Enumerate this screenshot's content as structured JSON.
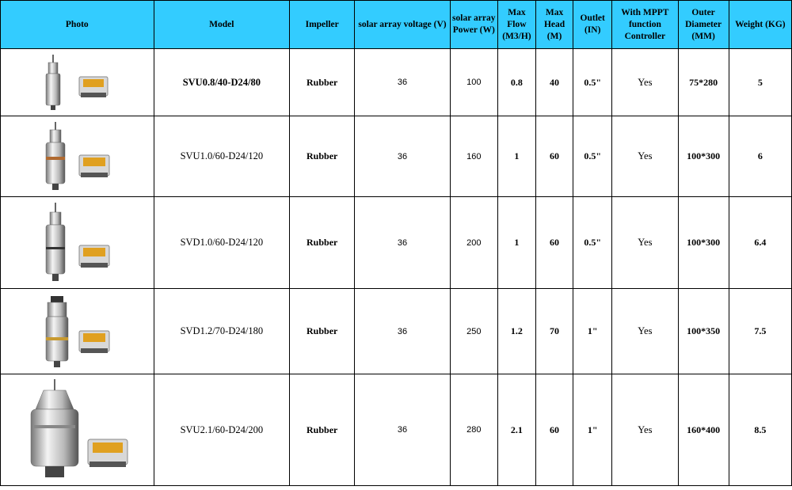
{
  "headers": {
    "photo": "Photo",
    "model": "Model",
    "impeller": "Impeller",
    "voltage": "solar array voltage (V)",
    "power": "solar array Power (W)",
    "flow": "Max Flow (M3/H)",
    "head": "Max Head (M)",
    "outlet": "Outlet (IN)",
    "mppt": "With MPPT function Controller",
    "diameter": "Outer Diameter (MM)",
    "weight": "Weight (KG)"
  },
  "rows": [
    {
      "model": "SVU0.8/40-D24/80",
      "impeller": "Rubber",
      "voltage": "36",
      "power": "100",
      "flow": "0.8",
      "head": "40",
      "outlet": "0.5\"",
      "mppt": "Yes",
      "diameter": "75*280",
      "weight": "5"
    },
    {
      "model": "SVU1.0/60-D24/120",
      "impeller": "Rubber",
      "voltage": "36",
      "power": "160",
      "flow": "1",
      "head": "60",
      "outlet": "0.5\"",
      "mppt": "Yes",
      "diameter": "100*300",
      "weight": "6"
    },
    {
      "model": "SVD1.0/60-D24/120",
      "impeller": "Rubber",
      "voltage": "36",
      "power": "200",
      "flow": "1",
      "head": "60",
      "outlet": "0.5\"",
      "mppt": "Yes",
      "diameter": "100*300",
      "weight": "6.4"
    },
    {
      "model": "SVD1.2/70-D24/180",
      "impeller": "Rubber",
      "voltage": "36",
      "power": "250",
      "flow": "1.2",
      "head": "70",
      "outlet": "1\"",
      "mppt": "Yes",
      "diameter": "100*350",
      "weight": "7.5"
    },
    {
      "model": "SVU2.1/60-D24/200",
      "impeller": "Rubber",
      "voltage": "36",
      "power": "280",
      "flow": "2.1",
      "head": "60",
      "outlet": "1\"",
      "mppt": "Yes",
      "diameter": "160*400",
      "weight": "8.5"
    }
  ],
  "colors": {
    "header_bg": "#33ccff",
    "border": "#000000"
  }
}
